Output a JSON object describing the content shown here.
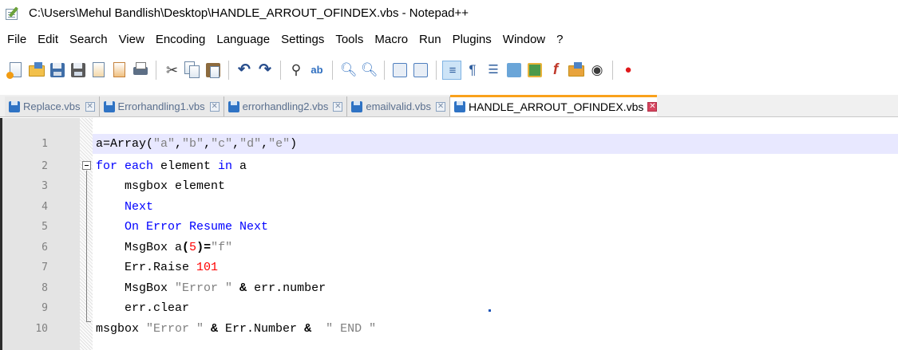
{
  "window": {
    "title": "C:\\Users\\Mehul Bandlish\\Desktop\\HANDLE_ARROUT_OFINDEX.vbs - Notepad++"
  },
  "menu": [
    "File",
    "Edit",
    "Search",
    "View",
    "Encoding",
    "Language",
    "Settings",
    "Tools",
    "Macro",
    "Run",
    "Plugins",
    "Window",
    "?"
  ],
  "toolbar": {
    "icons": [
      "new-file-icon",
      "open-file-icon",
      "save-icon",
      "save-all-icon",
      "close-icon",
      "close-all-icon",
      "print-icon",
      "cut-icon",
      "copy-icon",
      "paste-icon",
      "undo-icon",
      "redo-icon",
      "find-icon",
      "replace-icon",
      "zoom-in-icon",
      "zoom-out-icon",
      "sync-vertical-icon",
      "sync-horizontal-icon",
      "word-wrap-icon",
      "show-all-characters-icon",
      "indent-guide-icon",
      "user-defined-language-icon",
      "document-map-icon",
      "function-list-icon",
      "folder-as-workspace-icon",
      "monitoring-icon",
      "record-macro-icon"
    ]
  },
  "tabs": [
    {
      "label": "Replace.vbs",
      "active": false
    },
    {
      "label": "Errorhandling1.vbs",
      "active": false
    },
    {
      "label": "errorhandling2.vbs",
      "active": false
    },
    {
      "label": "emailvalid.vbs",
      "active": false
    },
    {
      "label": "HANDLE_ARROUT_OFINDEX.vbs",
      "active": true
    }
  ],
  "editor": {
    "line_numbers": [
      "1",
      "2",
      "3",
      "4",
      "5",
      "6",
      "7",
      "8",
      "9",
      "10"
    ],
    "lines": [
      [
        {
          "t": "a=Array(",
          "c": ""
        },
        {
          "t": "\"a\"",
          "c": "str"
        },
        {
          "t": ",",
          "c": ""
        },
        {
          "t": "\"b\"",
          "c": "str"
        },
        {
          "t": ",",
          "c": ""
        },
        {
          "t": "\"c\"",
          "c": "str"
        },
        {
          "t": ",",
          "c": ""
        },
        {
          "t": "\"d\"",
          "c": "str"
        },
        {
          "t": ",",
          "c": ""
        },
        {
          "t": "\"e\"",
          "c": "str"
        },
        {
          "t": ")",
          "c": ""
        }
      ],
      [
        {
          "t": "for each",
          "c": "kw"
        },
        {
          "t": " element ",
          "c": ""
        },
        {
          "t": "in",
          "c": "kw"
        },
        {
          "t": " a",
          "c": ""
        }
      ],
      [
        {
          "t": "    msgbox element",
          "c": ""
        }
      ],
      [
        {
          "t": "    ",
          "c": ""
        },
        {
          "t": "Next",
          "c": "kw"
        }
      ],
      [
        {
          "t": "    ",
          "c": ""
        },
        {
          "t": "On Error Resume Next",
          "c": "kw"
        }
      ],
      [
        {
          "t": "    MsgBox a",
          "c": ""
        },
        {
          "t": "(",
          "c": "op"
        },
        {
          "t": "5",
          "c": "num"
        },
        {
          "t": ")=",
          "c": "op"
        },
        {
          "t": "\"f\"",
          "c": "str"
        }
      ],
      [
        {
          "t": "    Err.Raise ",
          "c": ""
        },
        {
          "t": "101",
          "c": "num"
        }
      ],
      [
        {
          "t": "    MsgBox ",
          "c": ""
        },
        {
          "t": "\"Error \"",
          "c": "str"
        },
        {
          "t": " & ",
          "c": "op"
        },
        {
          "t": "err.number",
          "c": ""
        }
      ],
      [
        {
          "t": "    err.clear",
          "c": ""
        }
      ],
      [
        {
          "t": "msgbox ",
          "c": ""
        },
        {
          "t": "\"Error \"",
          "c": "str"
        },
        {
          "t": " & ",
          "c": "op"
        },
        {
          "t": "Err.Number ",
          "c": ""
        },
        {
          "t": "& ",
          "c": "op"
        },
        {
          "t": " \" END \"",
          "c": "str"
        }
      ]
    ]
  }
}
